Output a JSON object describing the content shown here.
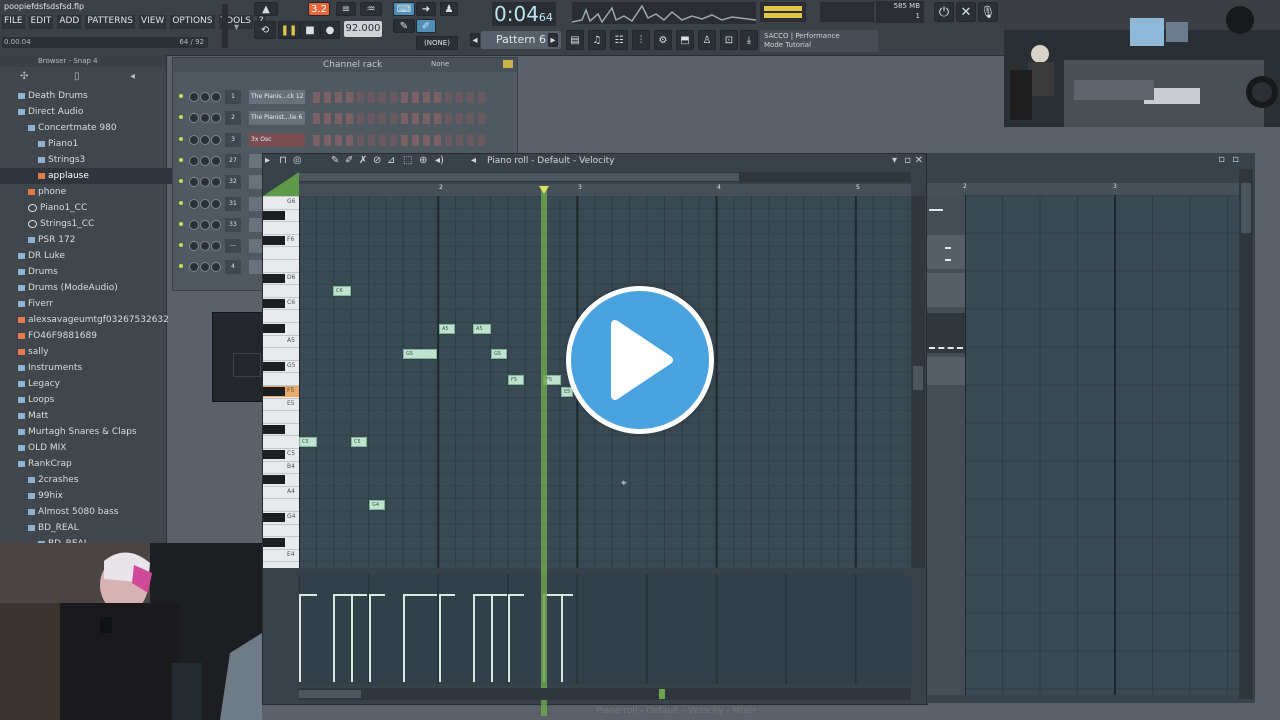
{
  "window": {
    "file_title": "poopiefdsfsdsfsd.flp",
    "menu": [
      "FILE",
      "EDIT",
      "ADD",
      "PATTERNS",
      "VIEW",
      "OPTIONS",
      "TOOLS",
      "?"
    ],
    "hint_left": "0.00.04",
    "hint_right": "64 / 92"
  },
  "transport": {
    "pattern_indicator": "3.2",
    "song_time": "0:04",
    "song_time_small": "64",
    "tempo": "92.000",
    "pattern_name": "Pattern 6",
    "snap": "(NONE)",
    "mode_info_line1": "SACCO | Performance",
    "mode_info_line2": "Mode Tutorial",
    "memory": "585 MB",
    "cpu": "1"
  },
  "browser": {
    "header": "Browser - Snap 4",
    "items": [
      {
        "label": "Death Drums",
        "indent": 1,
        "type": "folder"
      },
      {
        "label": "Direct Audio",
        "indent": 1,
        "type": "folder"
      },
      {
        "label": "Concertmate 980",
        "indent": 2,
        "type": "folder"
      },
      {
        "label": "Piano1",
        "indent": 3,
        "type": "folder"
      },
      {
        "label": "Strings3",
        "indent": 3,
        "type": "folder"
      },
      {
        "label": "applause",
        "indent": 3,
        "type": "file-selected"
      },
      {
        "label": "phone",
        "indent": 2,
        "type": "file"
      },
      {
        "label": "Piano1_CC",
        "indent": 2,
        "type": "plugin"
      },
      {
        "label": "Strings1_CC",
        "indent": 2,
        "type": "plugin"
      },
      {
        "label": "PSR 172",
        "indent": 2,
        "type": "folder"
      },
      {
        "label": "DR Luke",
        "indent": 1,
        "type": "folder"
      },
      {
        "label": "Drums",
        "indent": 1,
        "type": "folder"
      },
      {
        "label": "Drums (ModeAudio)",
        "indent": 1,
        "type": "folder"
      },
      {
        "label": "Fiverr",
        "indent": 1,
        "type": "folder"
      },
      {
        "label": "alexsavageumtgf03267532632",
        "indent": 1,
        "type": "file"
      },
      {
        "label": "FO46F9881689",
        "indent": 1,
        "type": "file"
      },
      {
        "label": "sally",
        "indent": 1,
        "type": "file"
      },
      {
        "label": "Instruments",
        "indent": 1,
        "type": "folder"
      },
      {
        "label": "Legacy",
        "indent": 1,
        "type": "folder"
      },
      {
        "label": "Loops",
        "indent": 1,
        "type": "folder"
      },
      {
        "label": "Matt",
        "indent": 1,
        "type": "folder"
      },
      {
        "label": "Murtagh Snares & Claps",
        "indent": 1,
        "type": "folder"
      },
      {
        "label": "OLD MIX",
        "indent": 1,
        "type": "folder"
      },
      {
        "label": "RankCrap",
        "indent": 1,
        "type": "folder"
      },
      {
        "label": "2crashes",
        "indent": 2,
        "type": "folder"
      },
      {
        "label": "99hix",
        "indent": 2,
        "type": "folder"
      },
      {
        "label": "Almost 5080 bass",
        "indent": 2,
        "type": "folder"
      },
      {
        "label": "BD_REAL",
        "indent": 2,
        "type": "folder"
      },
      {
        "label": "BD_REAL",
        "indent": 3,
        "type": "folder"
      }
    ]
  },
  "channel_rack": {
    "title": "Channel rack",
    "filter": "None",
    "channels": [
      {
        "num": "1",
        "name": "The Pianis...ck 12"
      },
      {
        "num": "2",
        "name": "The Pianist...lie 6"
      },
      {
        "num": "3",
        "name": "3x Osc"
      },
      {
        "num": "27",
        "name": ""
      },
      {
        "num": "32",
        "name": ""
      },
      {
        "num": "31",
        "name": ""
      },
      {
        "num": "33",
        "name": ""
      },
      {
        "num": "—",
        "name": ""
      },
      {
        "num": "4",
        "name": ""
      }
    ]
  },
  "piano_roll": {
    "title": "Piano roll - Default - Velocity",
    "bar_numbers": [
      "2",
      "3",
      "4",
      "5"
    ],
    "key_labels": [
      "G6",
      "F6",
      "D6",
      "C6",
      "A5",
      "G5",
      "F5",
      "E5",
      "C5",
      "B4",
      "A4",
      "G4",
      "E4"
    ],
    "notes": [
      {
        "label": "C6"
      },
      {
        "label": "A5"
      },
      {
        "label": "A5"
      },
      {
        "label": "G5"
      },
      {
        "label": "G5"
      },
      {
        "label": "F5"
      },
      {
        "label": "F5"
      },
      {
        "label": "E5"
      },
      {
        "label": "C5"
      },
      {
        "label": "C5"
      },
      {
        "label": "G4"
      }
    ]
  },
  "playlist": {
    "bar_numbers": [
      "2",
      "3"
    ]
  },
  "status_bar": "Piano roll - Default - Velocity - Mixer",
  "colors": {
    "accent_green": "#6ca34c",
    "note_fill": "#bfe3cf",
    "play_button": "#4aa3df",
    "record_orange": "#e8673a"
  }
}
